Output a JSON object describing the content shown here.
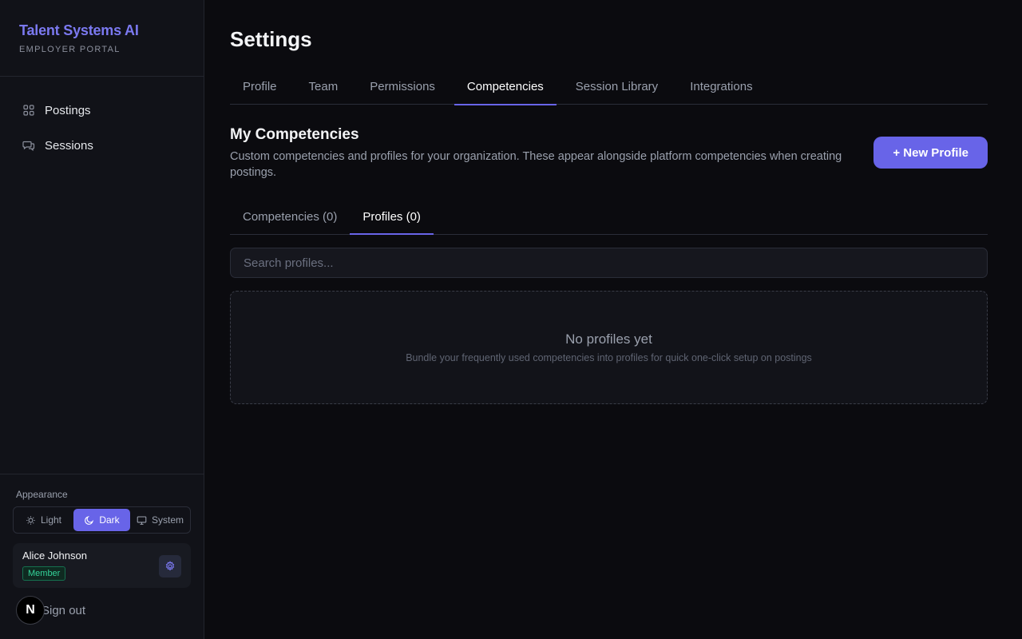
{
  "brand": {
    "title": "Talent Systems AI",
    "subtitle": "EMPLOYER PORTAL"
  },
  "sidebar": {
    "items": [
      {
        "label": "Postings",
        "icon": "grid-icon"
      },
      {
        "label": "Sessions",
        "icon": "chat-icon"
      }
    ],
    "appearance": {
      "label": "Appearance",
      "options": [
        "Light",
        "Dark",
        "System"
      ],
      "selected": "Dark"
    },
    "user": {
      "name": "Alice Johnson",
      "role": "Member"
    },
    "signout": "Sign out",
    "badge": "N"
  },
  "page": {
    "title": "Settings"
  },
  "tabs": [
    "Profile",
    "Team",
    "Permissions",
    "Competencies",
    "Session Library",
    "Integrations"
  ],
  "active_tab": "Competencies",
  "section": {
    "title": "My Competencies",
    "description": "Custom competencies and profiles for your organization. These appear alongside platform competencies when creating postings.",
    "new_button": "+ New Profile"
  },
  "subtabs": [
    "Competencies (0)",
    "Profiles (0)"
  ],
  "active_subtab": "Profiles (0)",
  "search": {
    "placeholder": "Search profiles...",
    "value": ""
  },
  "empty": {
    "title": "No profiles yet",
    "subtitle": "Bundle your frequently used competencies into profiles for quick one-click setup on postings"
  },
  "colors": {
    "accent": "#6864e8",
    "brand": "#7b79f0",
    "member": "#34d399",
    "background": "#0b0b0f"
  }
}
